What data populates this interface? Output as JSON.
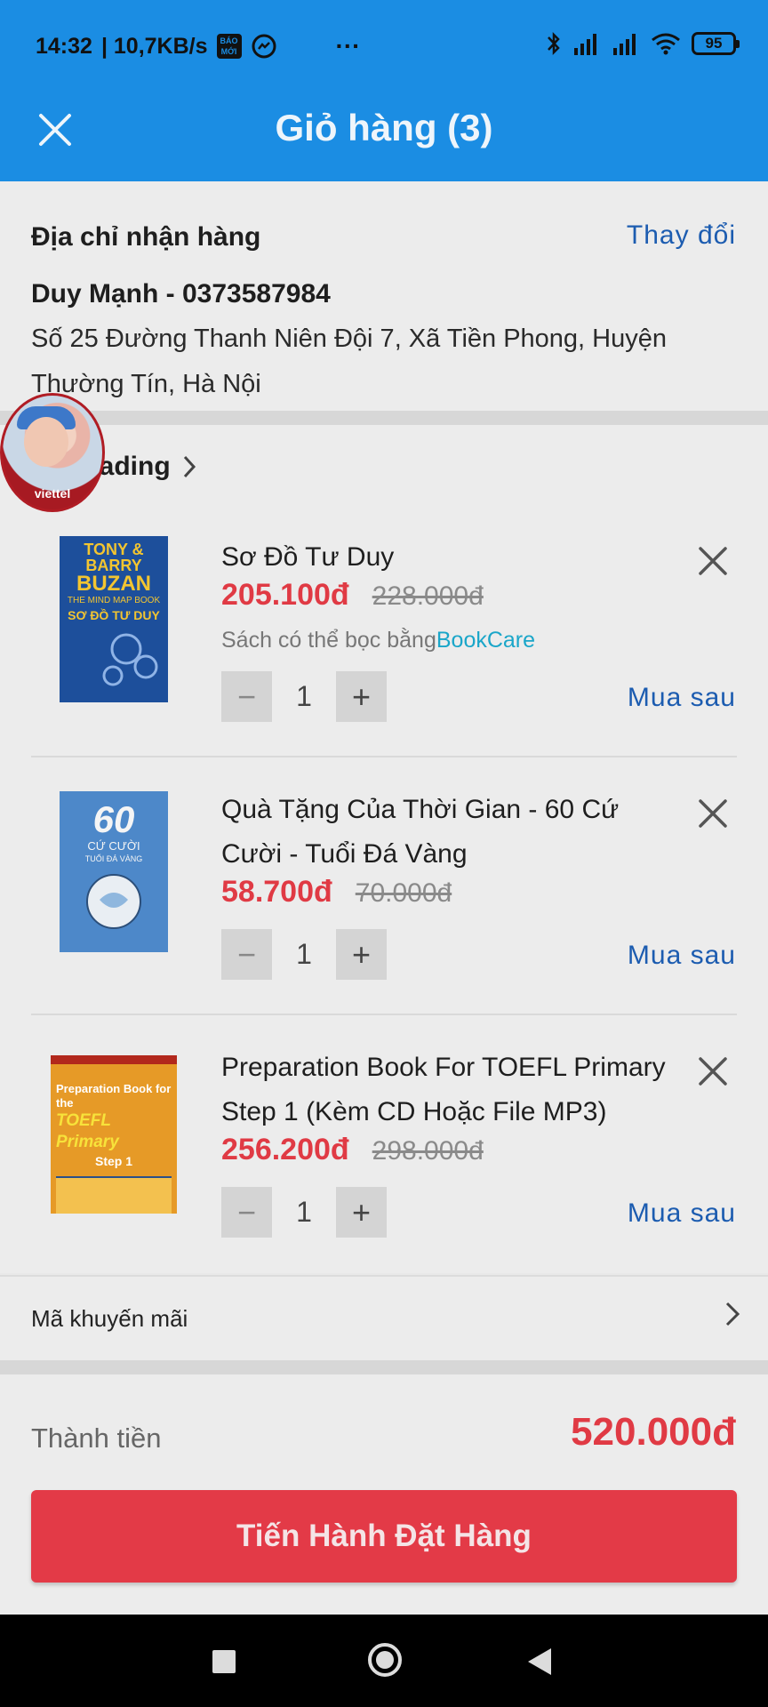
{
  "status_bar": {
    "time": "14:32",
    "speed": "| 10,7KB/s",
    "app_icon_text": "BÁO MỚI",
    "more": "···",
    "battery": "95",
    "icons": [
      "bao-moi-icon",
      "messenger-icon",
      "bluetooth-icon",
      "signal-icon",
      "signal-icon",
      "wifi-icon",
      "battery-icon"
    ]
  },
  "header": {
    "title": "Giỏ hàng (3)",
    "close_icon": "close-icon"
  },
  "address": {
    "label": "Địa chỉ nhận hàng",
    "change": "Thay đổi",
    "name_phone": "Duy Mạnh - 0373587984",
    "line": "Số 25 Đường Thanh Niên Đội 7, Xã Tiền Phong, Huyện Thường Tín, Hà Nội"
  },
  "shop": {
    "name": "rading",
    "avatar_brand": "viettel"
  },
  "items": [
    {
      "title": "Sơ Đồ Tư Duy",
      "price": "205.100đ",
      "old_price": "228.000đ",
      "bookcare_prefix": "Sách có thể bọc bằng",
      "bookcare_brand": "BookCare",
      "qty": "1",
      "later": "Mua sau",
      "cover_line1": "TONY &",
      "cover_line2": "BARRY",
      "cover_line3": "BUZAN",
      "cover_line4": "THE MIND MAP BOOK",
      "cover_line5": "SƠ ĐỒ TƯ DUY"
    },
    {
      "title": "Quà Tặng Của Thời Gian - 60 Cứ Cười - Tuổi Đá Vàng",
      "price": "58.700đ",
      "old_price": "70.000đ",
      "qty": "1",
      "later": "Mua sau",
      "cover_line1": "60",
      "cover_line2": "CỨ CƯỜI",
      "cover_line3": "TUỔI ĐÁ VÀNG"
    },
    {
      "title": "Preparation Book For TOEFL Primary Step 1 (Kèm CD Hoặc File MP3)",
      "price": "256.200đ",
      "old_price": "298.000đ",
      "qty": "1",
      "later": "Mua sau",
      "cover_line1": "Preparation Book for the",
      "cover_line2": "TOEFL Primary",
      "cover_line3": "Step 1"
    }
  ],
  "promo": {
    "label": "Mã khuyến mãi"
  },
  "totals": {
    "label": "Thành tiền",
    "value": "520.000đ",
    "checkout": "Tiến Hành Đặt Hàng"
  },
  "colors": {
    "primary_blue": "#1b8de3",
    "price_red": "#e03a44",
    "link_blue": "#1c5cb0",
    "bookcare_cyan": "#1aa6c9"
  }
}
